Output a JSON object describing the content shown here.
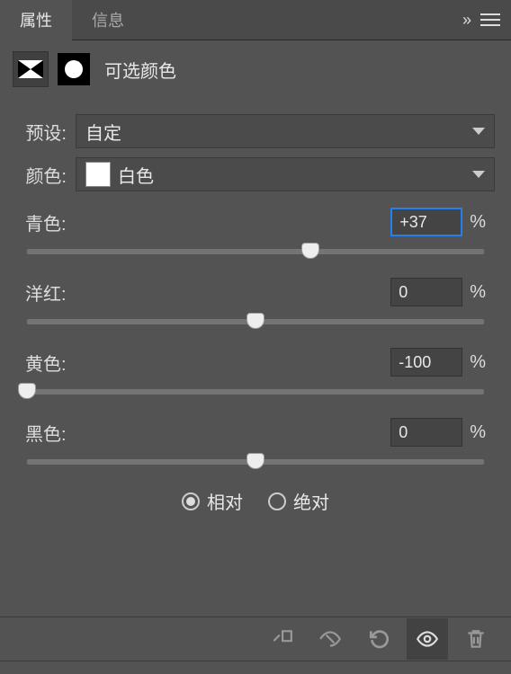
{
  "tabs": {
    "attrs": "属性",
    "info": "信息"
  },
  "title": "可选颜色",
  "preset": {
    "label": "预设:",
    "value": "自定"
  },
  "colors": {
    "label": "颜色:",
    "value": "白色",
    "swatch": "#ffffff"
  },
  "sliders": {
    "cyan": {
      "label": "青色:",
      "value": "+37",
      "pos": 62
    },
    "magenta": {
      "label": "洋红:",
      "value": "0",
      "pos": 50
    },
    "yellow": {
      "label": "黄色:",
      "value": "-100",
      "pos": 0
    },
    "black": {
      "label": "黑色:",
      "value": "0",
      "pos": 50
    }
  },
  "method": {
    "relative": "相对",
    "absolute": "绝对",
    "selected": "relative"
  },
  "pct": "%"
}
